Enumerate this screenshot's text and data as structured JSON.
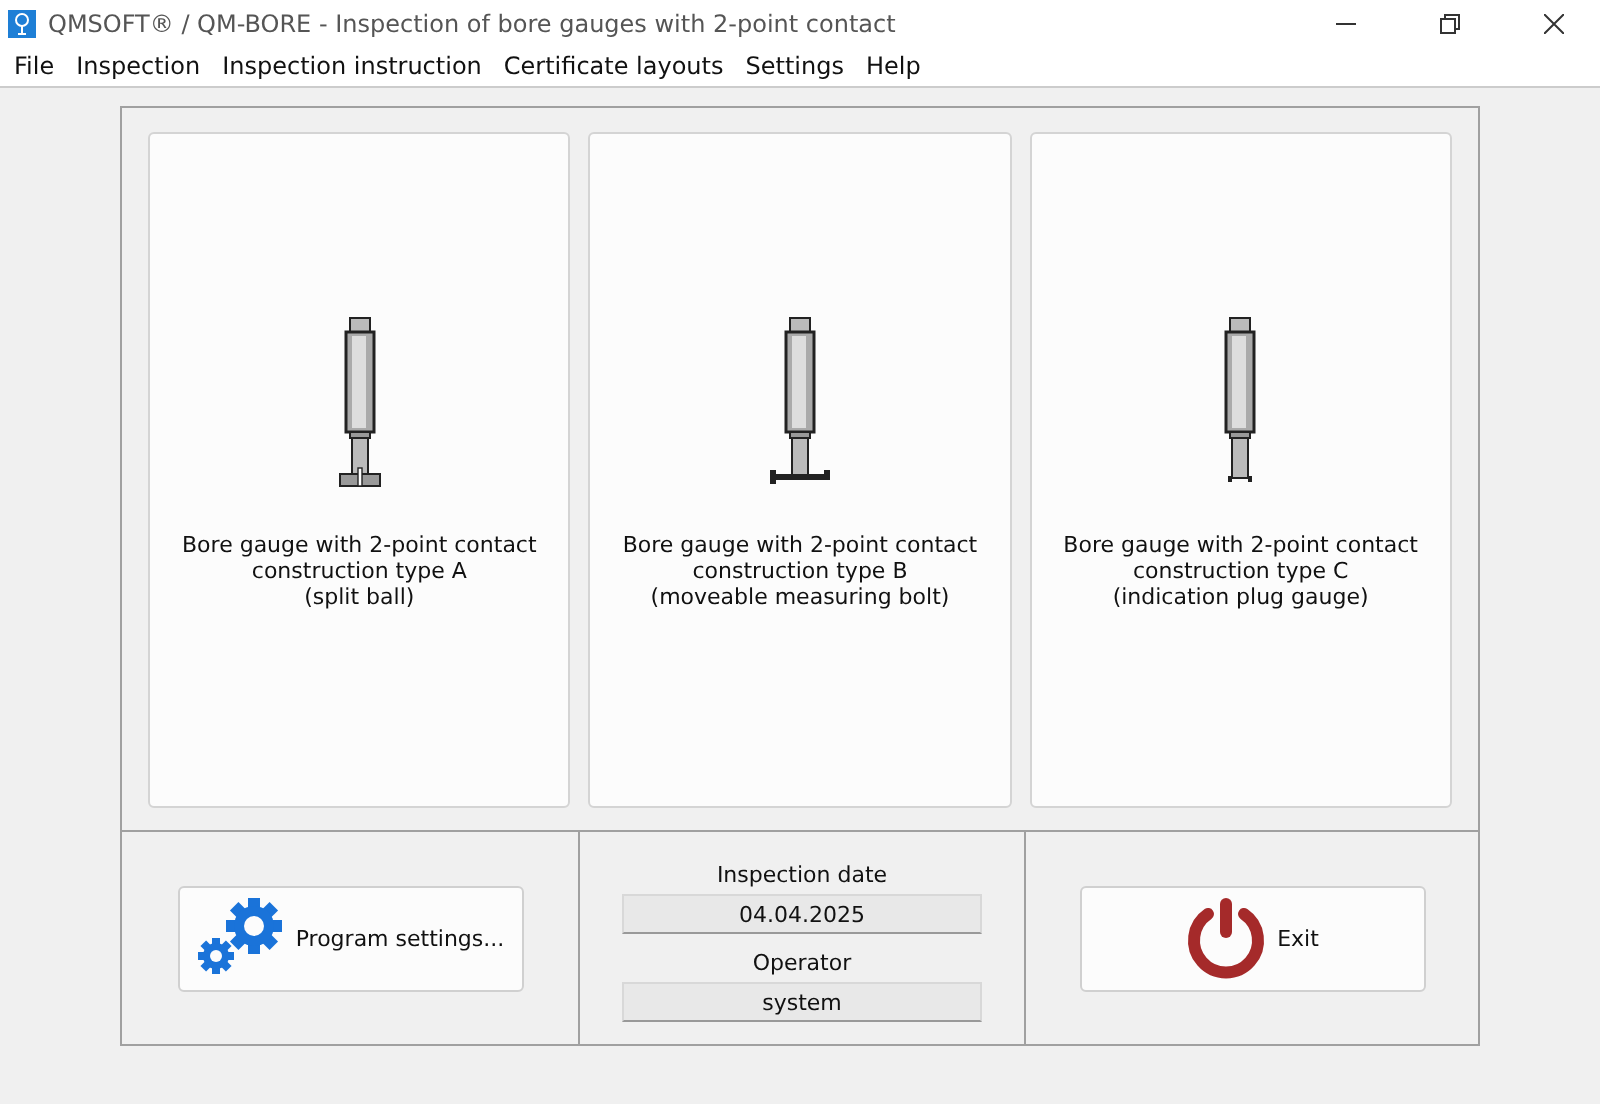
{
  "window": {
    "title": "QMSOFT® / QM-BORE - Inspection of bore gauges with 2-point contact"
  },
  "menu": [
    "File",
    "Inspection",
    "Inspection instruction",
    "Certificate layouts",
    "Settings",
    "Help"
  ],
  "cards": [
    {
      "kind": "split-ball",
      "lines": [
        "Bore gauge with 2-point contact",
        "construction type A",
        "(split ball)"
      ]
    },
    {
      "kind": "moveable-bolt",
      "lines": [
        "Bore gauge with 2-point contact",
        "construction type B",
        "(moveable measuring bolt)"
      ]
    },
    {
      "kind": "plug",
      "lines": [
        "Bore gauge with 2-point contact",
        "construction type C",
        "(indication plug gauge)"
      ]
    }
  ],
  "settings_button": "Program settings...",
  "inspection_date": {
    "label": "Inspection date",
    "value": "04.04.2025"
  },
  "operator": {
    "label": "Operator",
    "value": "system"
  },
  "exit_button": "Exit"
}
